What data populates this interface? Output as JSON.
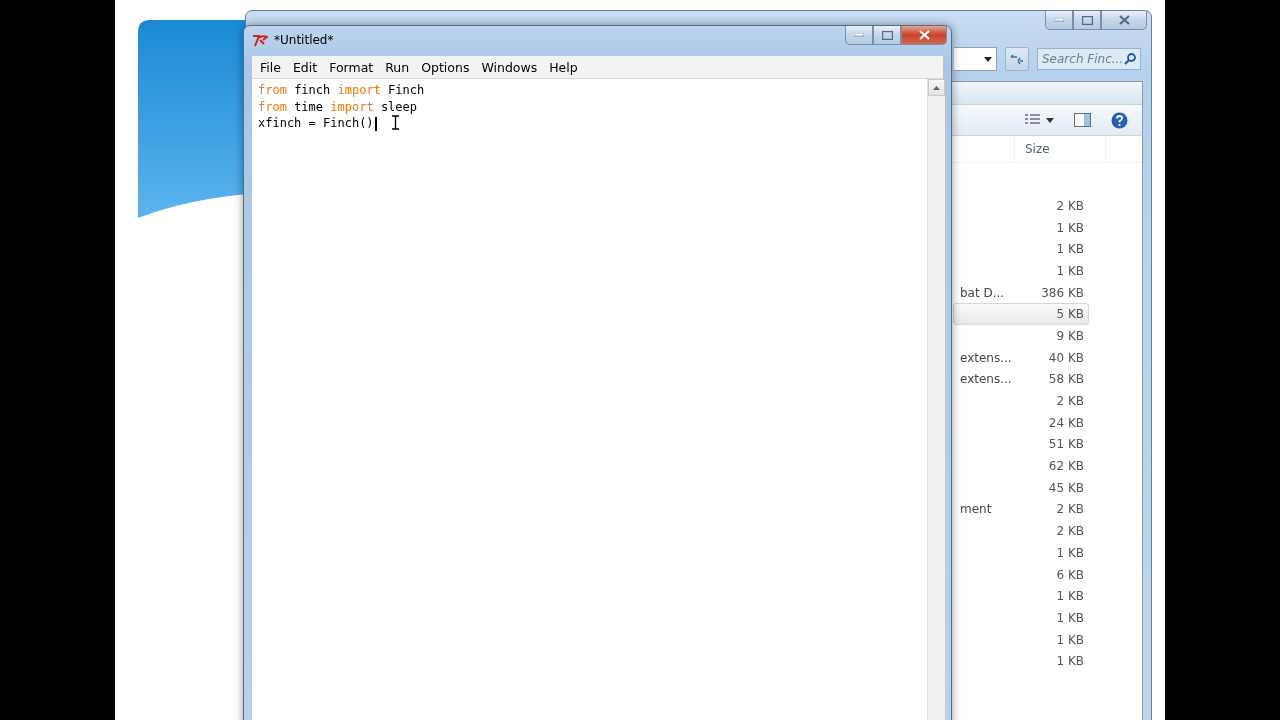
{
  "editor": {
    "title": "*Untitled*",
    "menu": [
      "File",
      "Edit",
      "Format",
      "Run",
      "Options",
      "Windows",
      "Help"
    ],
    "code": [
      [
        {
          "kind": "keyword",
          "text": "from"
        },
        {
          "kind": "plain",
          "text": "finch"
        },
        {
          "kind": "keyword",
          "text": "import"
        },
        {
          "kind": "plain",
          "text": "Finch"
        }
      ],
      [
        {
          "kind": "keyword",
          "text": "from"
        },
        {
          "kind": "plain",
          "text": "time"
        },
        {
          "kind": "keyword",
          "text": "import"
        },
        {
          "kind": "plain",
          "text": "sleep"
        }
      ],
      [
        {
          "kind": "plain",
          "text": "xfinch = Finch()"
        }
      ]
    ]
  },
  "explorer": {
    "search": {
      "placeholder": "Search Finc..."
    },
    "column": "Size",
    "rows": [
      {
        "size": "2 KB",
        "selected": false
      },
      {
        "size": "1 KB",
        "selected": false
      },
      {
        "size": "1 KB",
        "selected": false
      },
      {
        "size": "1 KB",
        "selected": false
      },
      {
        "name": "bat D...",
        "size": "386 KB",
        "selected": false
      },
      {
        "size": "5 KB",
        "selected": true
      },
      {
        "size": "9 KB",
        "selected": false
      },
      {
        "name": "extens...",
        "size": "40 KB",
        "selected": false
      },
      {
        "name": "extens...",
        "size": "58 KB",
        "selected": false
      },
      {
        "size": "2 KB",
        "selected": false
      },
      {
        "size": "24 KB",
        "selected": false
      },
      {
        "size": "51 KB",
        "selected": false
      },
      {
        "size": "62 KB",
        "selected": false
      },
      {
        "size": "45 KB",
        "selected": false
      },
      {
        "name": "ment",
        "size": "2 KB",
        "selected": false
      },
      {
        "size": "2 KB",
        "selected": false
      },
      {
        "size": "1 KB",
        "selected": false
      },
      {
        "size": "6 KB",
        "selected": false
      },
      {
        "size": "1 KB",
        "selected": false
      },
      {
        "size": "1 KB",
        "selected": false
      },
      {
        "size": "1 KB",
        "selected": false
      },
      {
        "size": "1 KB",
        "selected": false
      }
    ]
  }
}
